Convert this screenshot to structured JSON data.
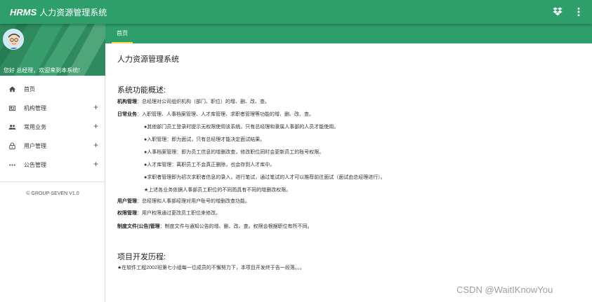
{
  "app": {
    "brand": "HRMS",
    "system_name": "人力资源管理系统",
    "colors": {
      "primary": "#2e9e6b",
      "tab_indicator": "#ffd54f"
    }
  },
  "topbar": {
    "icons": [
      "dropbox-icon",
      "more-vertical-icon"
    ]
  },
  "sidebar": {
    "greeting": "您好 总经理，欢迎来到本系统!",
    "items": [
      {
        "label": "首页",
        "icon": "home-icon",
        "expandable": false
      },
      {
        "label": "机构管理",
        "icon": "id-card-icon",
        "expandable": true
      },
      {
        "label": "常用业务",
        "icon": "people-icon",
        "expandable": true
      },
      {
        "label": "用户管理",
        "icon": "lock-icon",
        "expandable": true
      },
      {
        "label": "公告管理",
        "icon": "more-horizontal-icon",
        "expandable": true
      }
    ],
    "footer": "© GROUP-SEVEN V1.0"
  },
  "tabs": [
    {
      "label": "首页",
      "active": true
    }
  ],
  "main": {
    "title": "人力资源管理系统",
    "overview_title": "系统功能概述:",
    "org": {
      "label": "机构管理",
      "text": "总经理对公司组织机构（部门、职位）的增、删、改、查。"
    },
    "daily": {
      "label": "日常业务",
      "text": "入职管理、人事档案管理、人才库管理、求职者管理等功能的增、删、改、查。",
      "bullets": [
        "●其他部门员工登录时提示无权限使用该系统。只有总经理和隶属人事部的人员才能使用。",
        "●入职管理：即为面试，只有总经理才能决定面试结果。",
        "●人事档案管理：即为员工信息的增删改查，修改职位同时会更新员工的账号权限。",
        "●人才库管理：离职员工不会真正删除，也会存到人才库中。",
        "●求职者管理即为初次求职者信息的录入，进行笔试，通过笔试的人才可以推荐前往面试（面试由总经理进行）。",
        "★上述各业务依据人事部员工职位的不同而具有不同的增删改权限。"
      ]
    },
    "user": {
      "label": "用户管理",
      "text": "总经理和人事部经理对用户账号的增删改查功能。"
    },
    "permission": {
      "label": "权限管理",
      "text": "用户权限通过更改员工职位来修改。"
    },
    "policy": {
      "label": "制度文件(公告)管理",
      "text": "制度文件与通知公告的增、删、改、查。权限会根据职位有所不同。"
    },
    "history_title": "项目开发历程:",
    "history_text": "★在软件工程2002班第七小组每一位成员的不懈努力下，本项目开发终于告一段落。。。"
  },
  "watermark": "CSDN @WaitIKnowYou"
}
